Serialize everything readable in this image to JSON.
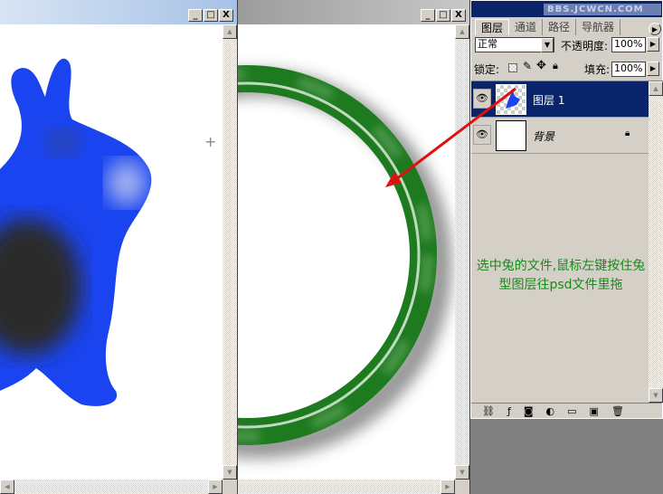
{
  "left_window": {
    "buttons": {
      "minimize": "_",
      "maximize": "□",
      "close": "X"
    }
  },
  "right_window": {
    "buttons": {
      "minimize": "_",
      "maximize": "□",
      "close": "X"
    }
  },
  "panel": {
    "watermark": "BBS.JCWCN.COM",
    "tabs": [
      "图层",
      "通道",
      "路径",
      "导航器"
    ],
    "blend_mode": "正常",
    "opacity_label": "不透明度:",
    "opacity_value": "100%",
    "lock_label": "锁定:",
    "fill_label": "填充:",
    "fill_value": "100%",
    "layers": [
      {
        "name": "图层 1",
        "selected": true
      },
      {
        "name": "背景",
        "locked": true
      }
    ],
    "note": "选中兔的文件,鼠标左键按住兔型图层往psd文件里拖"
  },
  "colors": {
    "rabbit": "#1a44f0",
    "ring": "#1e7a1e",
    "arrow": "#e01010",
    "selection": "#0a246a"
  }
}
